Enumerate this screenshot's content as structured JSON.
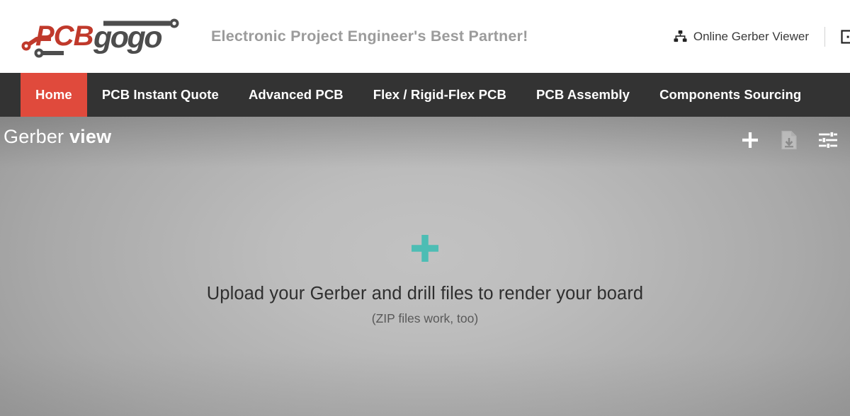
{
  "header": {
    "logo": {
      "name": "pcbgogo-logo",
      "text_primary": "PCB",
      "text_secondary": "gogo",
      "color_primary": "#c0392b",
      "color_secondary": "#4d4d4d"
    },
    "tagline": "Electronic Project Engineer's Best Partner!",
    "links": [
      {
        "id": "online-gerber-viewer",
        "label": "Online Gerber Viewer",
        "icon": "sitemap-icon"
      },
      {
        "id": "pcb-calculator",
        "label": "",
        "icon": "board-square-icon"
      }
    ]
  },
  "nav": {
    "items": [
      {
        "id": "home",
        "label": "Home",
        "active": true
      },
      {
        "id": "pcb-instant-quote",
        "label": "PCB Instant Quote",
        "active": false
      },
      {
        "id": "advanced-pcb",
        "label": "Advanced PCB",
        "active": false
      },
      {
        "id": "flex-rigid-flex-pcb",
        "label": "Flex / Rigid-Flex PCB",
        "active": false
      },
      {
        "id": "pcb-assembly",
        "label": "PCB Assembly",
        "active": false
      },
      {
        "id": "components-sourcing",
        "label": "Components Sourcing",
        "active": false
      }
    ],
    "active_color": "#e04a3c",
    "background_color": "#333333"
  },
  "gerber_panel": {
    "title_light": "Gerber",
    "title_bold": "view",
    "tools": [
      {
        "id": "add-layer",
        "icon": "plus-icon",
        "enabled": true
      },
      {
        "id": "download-file",
        "icon": "file-download-icon",
        "enabled": false
      },
      {
        "id": "render-settings",
        "icon": "sliders-icon",
        "enabled": true
      }
    ],
    "dropzone": {
      "plus_icon": "plus-icon",
      "plus_color": "#4dbdb4",
      "main_text": "Upload your Gerber and drill files to render your board",
      "sub_text": "(ZIP files work, too)"
    }
  }
}
